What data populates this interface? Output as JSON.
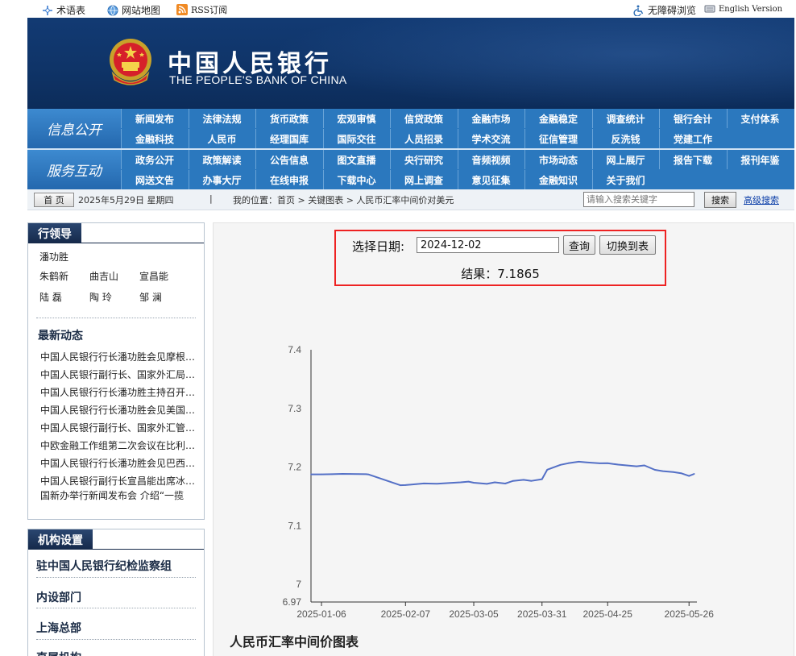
{
  "topbar": {
    "glossary": "术语表",
    "sitemap": "网站地图",
    "rss": "RSS订阅",
    "accessibility": "无障碍浏览",
    "english": "English Version"
  },
  "banner": {
    "name_cn": "中国人民银行",
    "name_en": "THE PEOPLE'S BANK OF CHINA"
  },
  "nav": {
    "group1_label": "信息公开",
    "group2_label": "服务互动",
    "rows": [
      [
        "新闻发布",
        "法律法规",
        "货币政策",
        "宏观审慎",
        "信贷政策",
        "金融市场",
        "金融稳定",
        "调查统计",
        "银行会计",
        "支付体系"
      ],
      [
        "金融科技",
        "人民币",
        "经理国库",
        "国际交往",
        "人员招录",
        "学术交流",
        "征信管理",
        "反洗钱",
        "党建工作"
      ],
      [
        "政务公开",
        "政策解读",
        "公告信息",
        "图文直播",
        "央行研究",
        "音频视频",
        "市场动态",
        "网上展厅",
        "报告下载",
        "报刊年鉴"
      ],
      [
        "网送文告",
        "办事大厅",
        "在线申报",
        "下载中心",
        "网上调查",
        "意见征集",
        "金融知识",
        "关于我们"
      ]
    ]
  },
  "crumb": {
    "home": "首 页",
    "date": "2025年5月29日 星期四",
    "separator": "|",
    "location": "我的位置：首页  >  关键图表  >  人民币汇率中间价对美元",
    "search_placeholder": "请输入搜索关键字",
    "search_button": "搜索",
    "advanced": "高级搜索"
  },
  "leaders": {
    "title": "行领导",
    "names": [
      "潘功胜",
      "朱鹤新",
      "曲吉山",
      "宣昌能",
      "陆  磊",
      "陶  玲",
      "邹  澜"
    ]
  },
  "news": {
    "title": "最新动态",
    "items": [
      "中国人民银行行长潘功胜会见摩根大通董事长",
      "中国人民银行副行长、国家外汇局局长朱鹤新",
      "中国人民银行行长潘功胜主持召开金融机构座",
      "中国人民银行行长潘功胜会见美国财政部官员",
      "中国人民银行副行长、国家外汇管理局局长",
      "中欧金融工作组第二次会议在比利时召开",
      "中国人民银行行长潘功胜会见巴西央行行长",
      "中国人民银行副行长宣昌能出席冰岛会议",
      "国新办举行新闻发布会 介绍“一揽"
    ]
  },
  "org": {
    "title": "机构设置",
    "items": [
      "驻中国人民银行纪检监察组",
      "内设部门",
      "上海总部",
      "直属机构"
    ]
  },
  "query": {
    "date_label": "选择日期:",
    "date_value": "2024-12-02",
    "query_button": "查询",
    "switch_button": "切换到表",
    "result": "结果：7.1865"
  },
  "chart_title": "人民币汇率中间价图表",
  "colors": {
    "line": "#5470c6",
    "nav": "#2b78be",
    "banner": "#0f3468",
    "highlight": "#e22222"
  },
  "chart_data": {
    "type": "line",
    "x_ticks": [
      "2025-01-06",
      "2025-02-07",
      "2025-03-05",
      "2025-03-31",
      "2025-04-25",
      "2025-05-26"
    ],
    "y_ticks": [
      "6.97",
      "7",
      "7.1",
      "7.2",
      "7.3",
      "7.4"
    ],
    "ylim": [
      6.97,
      7.4
    ],
    "x": [
      "2025-01-02",
      "2025-01-06",
      "2025-01-10",
      "2025-01-14",
      "2025-01-17",
      "2025-01-20",
      "2025-01-23",
      "2025-01-24",
      "2025-02-05",
      "2025-02-07",
      "2025-02-11",
      "2025-02-14",
      "2025-02-19",
      "2025-02-24",
      "2025-02-28",
      "2025-03-03",
      "2025-03-05",
      "2025-03-10",
      "2025-03-13",
      "2025-03-17",
      "2025-03-20",
      "2025-03-24",
      "2025-03-27",
      "2025-03-31",
      "2025-04-02",
      "2025-04-07",
      "2025-04-10",
      "2025-04-14",
      "2025-04-17",
      "2025-04-22",
      "2025-04-25",
      "2025-04-29",
      "2025-05-06",
      "2025-05-09",
      "2025-05-13",
      "2025-05-16",
      "2025-05-20",
      "2025-05-23",
      "2025-05-26",
      "2025-05-28"
    ],
    "values": [
      7.1876,
      7.1876,
      7.1879,
      7.1885,
      7.1883,
      7.1882,
      7.1879,
      7.1874,
      7.1691,
      7.1693,
      7.1708,
      7.1721,
      7.1716,
      7.173,
      7.174,
      7.1752,
      7.1733,
      7.1714,
      7.174,
      7.172,
      7.1765,
      7.1782,
      7.1765,
      7.1793,
      7.1956,
      7.2038,
      7.2066,
      7.2092,
      7.2081,
      7.2064,
      7.2066,
      7.2043,
      7.2014,
      7.2028,
      7.1953,
      7.1931,
      7.1916,
      7.1896,
      7.1848,
      7.1885
    ]
  }
}
